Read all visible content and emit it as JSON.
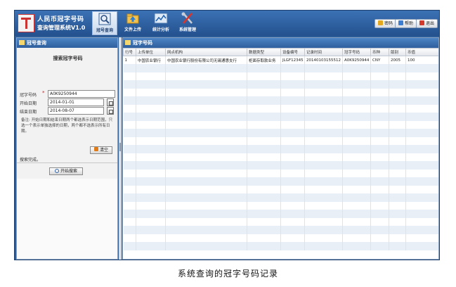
{
  "app": {
    "title_line1": "人民币冠字号码",
    "title_line2": "查询管理系统V1.0"
  },
  "nav": {
    "search": "冠号查询",
    "upload": "文件上传",
    "stats": "统计分析",
    "system": "系统管理"
  },
  "top_actions": {
    "password": "密码",
    "help": "帮助",
    "exit": "退出"
  },
  "left_panel": {
    "title": "冠号查询",
    "form_title": "搜索冠字号码",
    "account_label": "冠字号码",
    "account_value": "A0K9250944",
    "start_label": "开始日期",
    "start_value": "2014-01-01",
    "end_label": "结束日期",
    "end_value": "2014-08-07",
    "note": "备注: 开始日期和结束日期两个都选表示日期范围，只选一个表示单独选择的日期，两个都不选表示所有日期。",
    "clear_button": "清空",
    "status": "搜索完成。",
    "search_button": "开始搜索"
  },
  "right_panel": {
    "title": "冠字号码",
    "columns": [
      "行号",
      "上传单位",
      "网点机构",
      "数据类型",
      "设备编号",
      "记录时间",
      "冠字号码",
      "币种",
      "版别",
      "币值"
    ],
    "rows": [
      [
        "1",
        "中国农业银行",
        "中国农业银行股份有限公司无锡通惠支行",
        "柜面存取款业务",
        "JLGF12345",
        "20140103155512",
        "A0K9250944",
        "CNY",
        "2005",
        "100"
      ]
    ]
  },
  "caption": "系统查询的冠字号码记录",
  "colors": {
    "frame": "#2d5d99",
    "header": "#3b72b5",
    "row_alt": "#e9eff7",
    "required": "#d11111"
  }
}
